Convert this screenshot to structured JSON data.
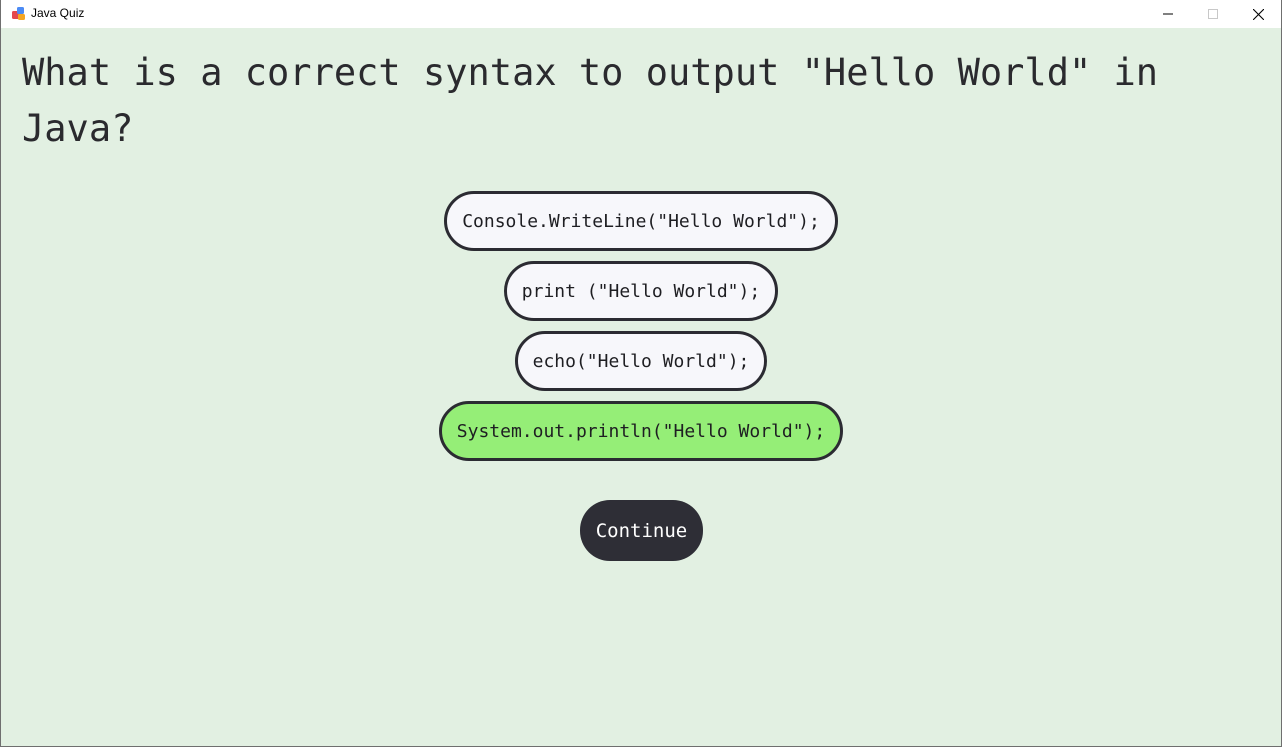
{
  "window": {
    "title": "Java Quiz",
    "controls": {
      "minimize_icon": "minimize-icon",
      "maximize_icon": "maximize-icon",
      "close_icon": "close-icon"
    }
  },
  "quiz": {
    "question": "What is a correct syntax to output \"Hello World\" in Java?",
    "options": [
      {
        "label": "Console.WriteLine(\"Hello World\");",
        "state": "default"
      },
      {
        "label": "print (\"Hello World\");",
        "state": "default"
      },
      {
        "label": "echo(\"Hello World\");",
        "state": "default"
      },
      {
        "label": "System.out.println(\"Hello World\");",
        "state": "correct"
      }
    ],
    "continue_label": "Continue"
  },
  "colors": {
    "background": "#e2f0e2",
    "option_fill": "#f7f7fb",
    "option_border": "#2b2b32",
    "correct_fill": "#95ee77",
    "continue_fill": "#2e2e36",
    "text": "#2a2a2e"
  }
}
